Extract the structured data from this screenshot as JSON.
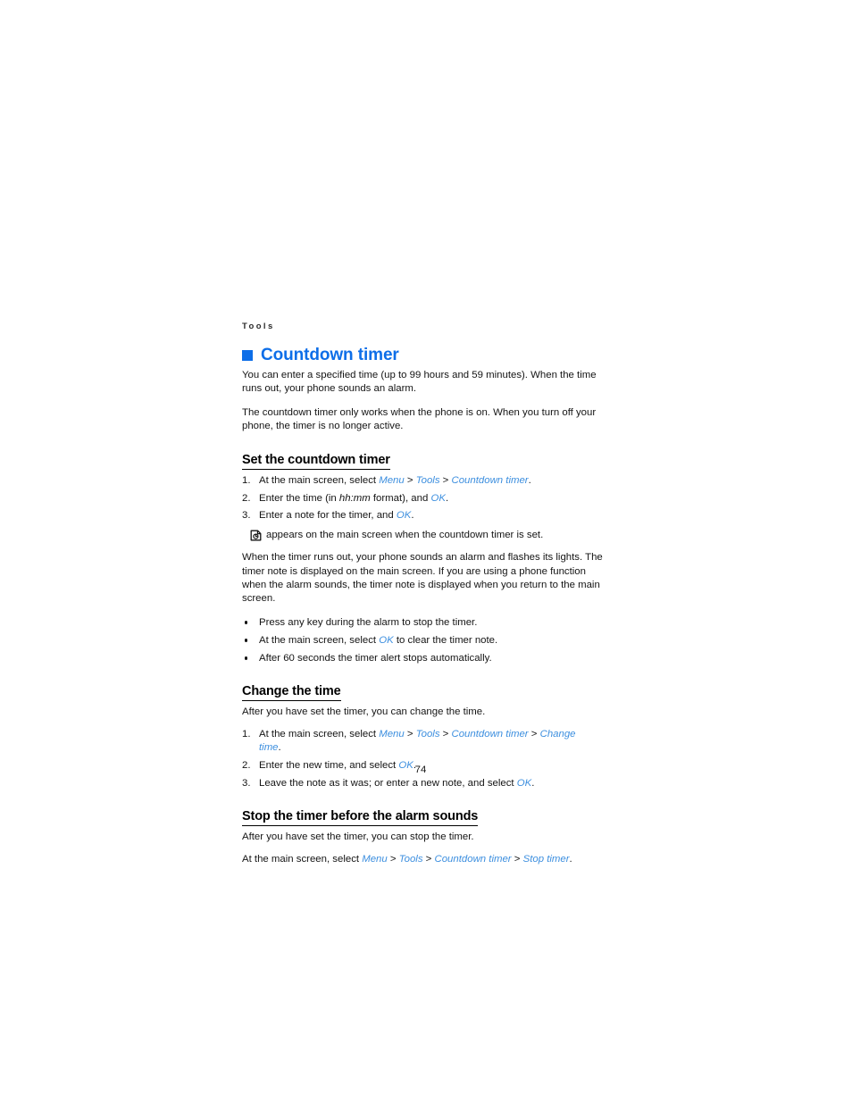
{
  "document": {
    "running_head": "Tools",
    "page_number": "74",
    "accent_color": "#0d6ee8",
    "link_color": "#3d8fdf",
    "text_color": "#141414"
  },
  "chapter": {
    "bullet_icon": "square-bullet-icon",
    "title": "Countdown timer",
    "intro_paragraphs": [
      "You can enter a specified time (up to 99 hours and 59 minutes). When the time runs out, your phone sounds an alarm.",
      "The countdown timer only works when the phone is on. When you turn off your phone, the timer is no longer active."
    ]
  },
  "sections": [
    {
      "heading": "Set the countdown timer",
      "steps": [
        {
          "num": "1.",
          "parts": [
            {
              "type": "plain",
              "text": "At the main screen, select "
            },
            {
              "type": "ui",
              "text": "Menu"
            },
            {
              "type": "sep",
              "text": " > "
            },
            {
              "type": "ui",
              "text": "Tools"
            },
            {
              "type": "sep",
              "text": " > "
            },
            {
              "type": "ui",
              "text": "Countdown timer"
            },
            {
              "type": "plain",
              "text": "."
            }
          ]
        },
        {
          "num": "2.",
          "parts": [
            {
              "type": "plain",
              "text": "Enter the time (in "
            },
            {
              "type": "var",
              "text": "hh:mm"
            },
            {
              "type": "plain",
              "text": " format), and "
            },
            {
              "type": "ui",
              "text": "OK"
            },
            {
              "type": "plain",
              "text": "."
            }
          ]
        },
        {
          "num": "3.",
          "parts": [
            {
              "type": "plain",
              "text": "Enter a note for the timer, and "
            },
            {
              "type": "ui",
              "text": "OK"
            },
            {
              "type": "plain",
              "text": "."
            }
          ]
        }
      ],
      "note": {
        "icon": "countdown-timer-icon",
        "text": "appears on the main screen when the countdown timer is set."
      },
      "paragraph": "When the timer runs out, your phone sounds an alarm and flashes its lights. The timer note is displayed on the main screen. If you are using a phone function when the alarm sounds, the timer note is displayed when you return to the main screen.",
      "bullets": [
        {
          "parts": [
            {
              "type": "plain",
              "text": "Press any key during the alarm to stop the timer."
            }
          ]
        },
        {
          "parts": [
            {
              "type": "plain",
              "text": "At the main screen, select "
            },
            {
              "type": "ui",
              "text": "OK"
            },
            {
              "type": "plain",
              "text": " to clear the timer note."
            }
          ]
        },
        {
          "parts": [
            {
              "type": "plain",
              "text": "After 60 seconds the timer alert stops automatically."
            }
          ]
        }
      ]
    },
    {
      "heading": "Change the time",
      "lead": "After you have set the timer, you can change the time.",
      "steps": [
        {
          "num": "1.",
          "parts": [
            {
              "type": "plain",
              "text": "At the main screen, select "
            },
            {
              "type": "ui",
              "text": "Menu"
            },
            {
              "type": "sep",
              "text": " > "
            },
            {
              "type": "ui",
              "text": "Tools"
            },
            {
              "type": "sep",
              "text": " > "
            },
            {
              "type": "ui",
              "text": "Countdown timer"
            },
            {
              "type": "sep",
              "text": " > "
            },
            {
              "type": "ui",
              "text": "Change time"
            },
            {
              "type": "plain",
              "text": "."
            }
          ]
        },
        {
          "num": "2.",
          "parts": [
            {
              "type": "plain",
              "text": "Enter the new time, and select "
            },
            {
              "type": "ui",
              "text": "OK"
            },
            {
              "type": "plain",
              "text": "."
            }
          ]
        },
        {
          "num": "3.",
          "parts": [
            {
              "type": "plain",
              "text": "Leave the note as it was; or enter a new note, and select "
            },
            {
              "type": "ui",
              "text": "OK"
            },
            {
              "type": "plain",
              "text": "."
            }
          ]
        }
      ]
    },
    {
      "heading": "Stop the timer before the alarm sounds",
      "lead": "After you have set the timer, you can stop the timer.",
      "final_line": {
        "parts": [
          {
            "type": "plain",
            "text": "At the main screen, select "
          },
          {
            "type": "ui",
            "text": "Menu"
          },
          {
            "type": "sep",
            "text": " > "
          },
          {
            "type": "ui",
            "text": "Tools"
          },
          {
            "type": "sep",
            "text": " > "
          },
          {
            "type": "ui",
            "text": "Countdown timer"
          },
          {
            "type": "sep",
            "text": " > "
          },
          {
            "type": "ui",
            "text": "Stop timer"
          },
          {
            "type": "plain",
            "text": "."
          }
        ]
      }
    }
  ]
}
